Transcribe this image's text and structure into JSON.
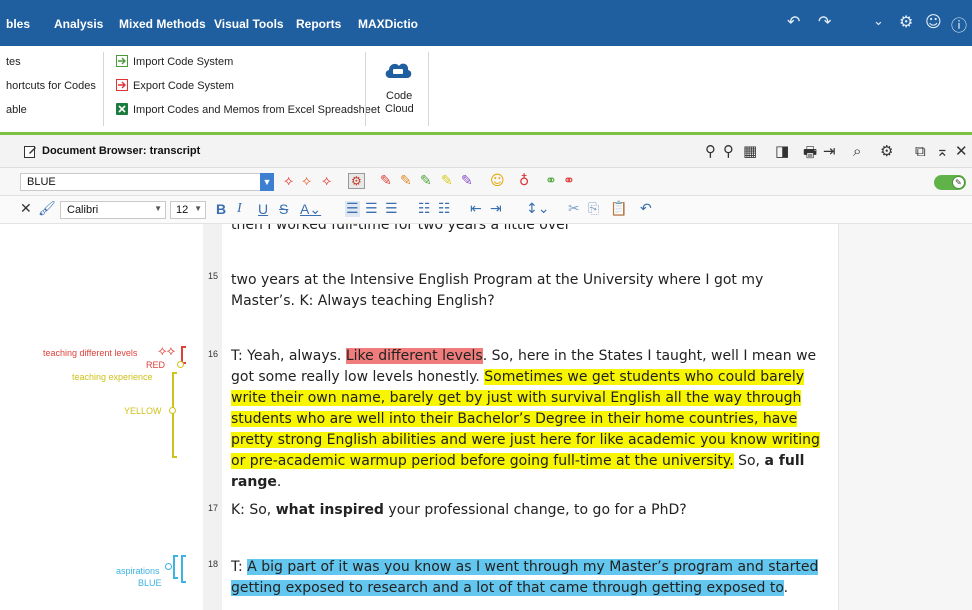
{
  "menubar": {
    "tabs": [
      "bles",
      "Analysis",
      "Mixed Methods",
      "Visual Tools",
      "Reports",
      "MAXDictio"
    ],
    "icons": [
      "undo-icon",
      "redo-icon",
      "chevron-down-icon",
      "gear-icon",
      "smiley-icon",
      "help-icon"
    ]
  },
  "ribbon": {
    "left_items": [
      "tes",
      "hortcuts for Codes",
      "able"
    ],
    "middle_items": [
      "Import Code System",
      "Export Code System",
      "Import Codes and Memos from Excel Spreadsheet"
    ],
    "cloud_label_1": "Code",
    "cloud_label_2": "Cloud"
  },
  "document_browser": {
    "title": "Document Browser: transcript"
  },
  "code_toolbar": {
    "selected_code": "BLUE"
  },
  "format_toolbar": {
    "font": "Calibri",
    "size": "12"
  },
  "document": {
    "top_partial": "then I worked full-time for two years a little over",
    "paragraphs": [
      {
        "num": "15",
        "text": "two years at the Intensive English Program at the University where I got my Master’s. K: Always teaching English?"
      },
      {
        "num": "16",
        "seg1": "T: Yeah, always. ",
        "seg_red": "Like different levels",
        "seg2": ". So, here in the States I taught, well I mean we got some really low levels honestly. ",
        "seg_yellow": "Sometimes we get students who could barely write their own name, barely get by just with survival English all the way through students who are well into their Bachelor’s Degree in their home countries, have pretty strong English abilities and were just here for like academic you know writing or pre-academic warmup period before going full-time at the university.",
        "seg3": " So, ",
        "seg_bold": "a full range",
        "seg4": "."
      },
      {
        "num": "17",
        "seg1": "K: So, ",
        "seg_bold": "what inspired",
        "seg2": " your professional change, to go for a PhD?"
      },
      {
        "num": "18",
        "seg1": "T: ",
        "seg_blue": "A big part of it was you know as I went through my Master’s program and started getting exposed to research and a lot of that came through getting exposed to",
        "seg2": "."
      }
    ]
  },
  "code_stripes": {
    "teaching_levels": "teaching different levels",
    "red": "RED",
    "teaching_experience": "teaching experience",
    "yellow": "YELLOW",
    "aspirations": "aspirations",
    "blue": "BLUE"
  },
  "colors": {
    "menubar": "#1f5fa0",
    "accent_green": "#7cc142",
    "highlight_red": "#f07c7c",
    "highlight_yellow": "#f8f500",
    "highlight_blue": "#63c6ee",
    "code_red": "#e0403a",
    "code_yellow": "#cfc21a",
    "code_blue": "#3db3e0"
  }
}
